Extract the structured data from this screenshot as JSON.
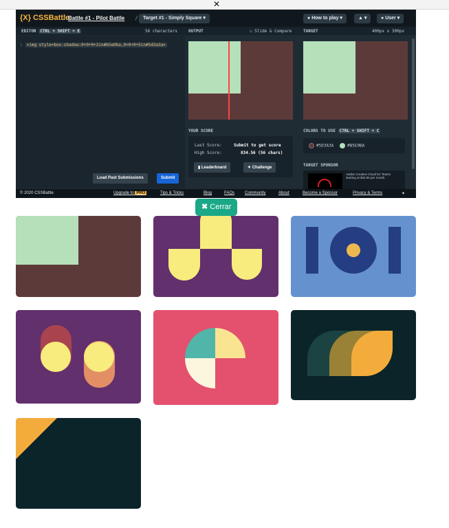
{
  "close_top": "✕",
  "header": {
    "logo_mark": "{X}",
    "logo": "CSSBattle",
    "battle": "Battle #1 - Pilot Battle",
    "target": "Target #1 - Simply Square",
    "how_to_play": "How to play",
    "user": "User"
  },
  "editor": {
    "label": "EDITOR",
    "shortcut": "CTRL + SHIFT + E",
    "chars": "56 characters",
    "line": "1",
    "code": "<img style=box-shadow:0+0+0+2in#b5e0ba,0+0+0+5in#5d3a3a>",
    "load_button": "Load Past Submissions",
    "submit_button": "Submit"
  },
  "output": {
    "label": "OUTPUT",
    "slide_compare": "Slide & Compare",
    "score_title": "YOUR SCORE",
    "last_label": "Last Score:",
    "last_value": "Submit to get score",
    "high_label": "High Score:",
    "high_value": "834.56 (56 chars)",
    "leaderboard": "Leaderboard",
    "challenge": "Challenge"
  },
  "target": {
    "label": "TARGET",
    "size": "400px x 300px",
    "colors_title": "COLORS TO USE",
    "colors_shortcut": "CTRL + SHIFT + C",
    "colors": [
      {
        "hex": "#5D3A3A",
        "color": "#5d3a3a"
      },
      {
        "hex": "#B5E0BA",
        "color": "#b5e0ba"
      }
    ],
    "sponsor_title": "TARGET SPONSOR",
    "sponsor_text": "Adobe Creative Cloud for Teams starting at $33.99 per month."
  },
  "footer": {
    "copyright": "© 2020 CSSBattle",
    "upgrade": "Upgrade to",
    "pro": "PRO",
    "links": [
      "Tips & Tricks",
      "Blog",
      "FAQs",
      "Community",
      "About",
      "Become a Sponsor",
      "Privacy & Terms"
    ]
  },
  "close_button": "Cerrar",
  "close_icon": "✖",
  "colors": {
    "accent": "#1ba888",
    "brown": "#5d3a3a",
    "mint": "#b5e0ba",
    "purple": "#62306d",
    "yellow": "#f7ec7d",
    "blue": "#6592cf",
    "navy": "#243d83",
    "gold": "#eeb850",
    "pink": "#e3516e",
    "dark_teal": "#0b2429"
  }
}
